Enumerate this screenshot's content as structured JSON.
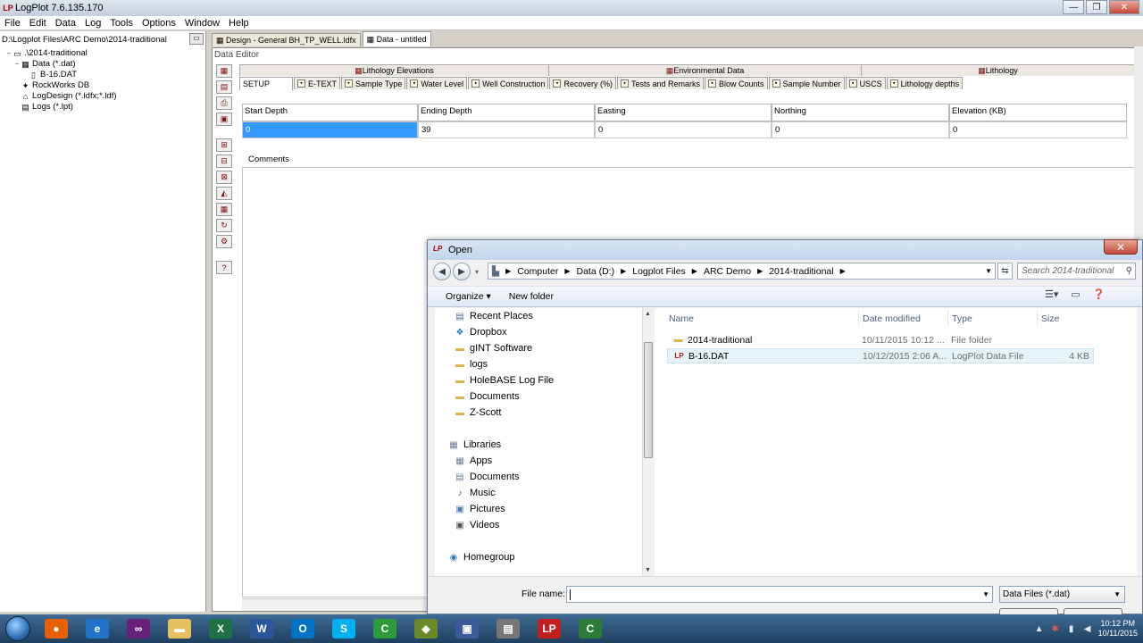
{
  "app": {
    "title": "LogPlot 7.6.135.170",
    "menu": [
      "File",
      "Edit",
      "Data",
      "Log",
      "Tools",
      "Options",
      "Window",
      "Help"
    ]
  },
  "left_pane": {
    "path": "D:\\Logplot Files\\ARC Demo\\2014-traditional",
    "tree": [
      {
        "label": ".\\2014-traditional",
        "indent": 0,
        "exp": "−",
        "icon": "folder-icon"
      },
      {
        "label": "Data (*.dat)",
        "indent": 1,
        "exp": "−",
        "icon": "data-table-icon"
      },
      {
        "label": "B-16.DAT",
        "indent": 2,
        "exp": "",
        "icon": "file-icon"
      },
      {
        "label": "RockWorks DB",
        "indent": 1,
        "exp": "",
        "icon": "rockworks-icon"
      },
      {
        "label": "LogDesign (*.ldfx;*.ldf)",
        "indent": 1,
        "exp": "",
        "icon": "logdesign-icon"
      },
      {
        "label": "Logs (*.lpt)",
        "indent": 1,
        "exp": "",
        "icon": "logs-icon"
      }
    ]
  },
  "doc_tabs": [
    {
      "label": "Design - General BH_TP_WELL.ldfx",
      "active": false
    },
    {
      "label": "Data - untitled",
      "active": true
    }
  ],
  "data_editor": {
    "title": "Data Editor",
    "sections": [
      {
        "label": "Lithology Elevations",
        "width": 346
      },
      {
        "label": "Environmental Data",
        "width": 350
      },
      {
        "label": "Lithology",
        "width": 306
      }
    ],
    "tabs": [
      "SETUP",
      "E-TEXT",
      "Sample Type",
      "Water Level",
      "Well Construction",
      "Recovery (%)",
      "Tests and Remarks",
      "Blow Counts",
      "Sample Number",
      "USCS",
      "Lithology depths"
    ],
    "columns": [
      "Start Depth",
      "Ending Depth",
      "Easting",
      "Northing",
      "Elevation (KB)"
    ],
    "values": [
      "0",
      "39",
      "0",
      "0",
      "0"
    ],
    "comments_label": "Comments"
  },
  "open_dialog": {
    "title": "Open",
    "breadcrumb": [
      "Computer",
      "Data (D:)",
      "Logplot Files",
      "ARC Demo",
      "2014-traditional"
    ],
    "search_placeholder": "Search 2014-traditional",
    "organize_label": "Organize ▾",
    "new_folder_label": "New folder",
    "nav_items": [
      {
        "label": "Recent Places",
        "icon": "recent-places-icon",
        "glyph": "▤",
        "color": "#4a6f9a",
        "level": 1
      },
      {
        "label": "Dropbox",
        "icon": "dropbox-icon",
        "glyph": "❖",
        "color": "#1e74c9",
        "level": 1
      },
      {
        "label": "gINT Software",
        "icon": "folder-icon",
        "glyph": "▬",
        "color": "#d9b44a",
        "level": 1
      },
      {
        "label": "logs",
        "icon": "folder-icon",
        "glyph": "▬",
        "color": "#d9b44a",
        "level": 1
      },
      {
        "label": "HoleBASE Log File",
        "icon": "folder-icon",
        "glyph": "▬",
        "color": "#d9b44a",
        "level": 1
      },
      {
        "label": "Documents",
        "icon": "folder-icon",
        "glyph": "▬",
        "color": "#d9b44a",
        "level": 1
      },
      {
        "label": "Z-Scott",
        "icon": "folder-icon",
        "glyph": "▬",
        "color": "#d9b44a",
        "level": 1
      },
      {
        "label": "Libraries",
        "icon": "libraries-icon",
        "glyph": "▦",
        "color": "#6b7f99",
        "level": 0
      },
      {
        "label": "Apps",
        "icon": "apps-icon",
        "glyph": "▦",
        "color": "#6b7f99",
        "level": 1
      },
      {
        "label": "Documents",
        "icon": "documents-icon",
        "glyph": "▤",
        "color": "#6b7f99",
        "level": 1
      },
      {
        "label": "Music",
        "icon": "music-icon",
        "glyph": "♪",
        "color": "#2f5f9a",
        "level": 1
      },
      {
        "label": "Pictures",
        "icon": "pictures-icon",
        "glyph": "▣",
        "color": "#4a7ab0",
        "level": 1
      },
      {
        "label": "Videos",
        "icon": "videos-icon",
        "glyph": "▣",
        "color": "#555",
        "level": 1
      },
      {
        "label": "Homegroup",
        "icon": "homegroup-icon",
        "glyph": "◉",
        "color": "#2d7fc1",
        "level": 0
      }
    ],
    "columns": [
      "Name",
      "Date modified",
      "Type",
      "Size"
    ],
    "files": [
      {
        "name": "2014-traditional",
        "date": "10/11/2015 10:12 ...",
        "type": "File folder",
        "size": "",
        "icon": "folder-icon"
      },
      {
        "name": "B-16.DAT",
        "date": "10/12/2015 2:06 A...",
        "type": "LogPlot Data File",
        "size": "4 KB",
        "icon": "logplot-file-icon"
      }
    ],
    "file_name_label": "File name:",
    "file_name_value": "",
    "file_type": "Data Files (*.dat)"
  },
  "taskbar": {
    "apps": [
      {
        "name": "firefox-icon",
        "glyph": "●",
        "bg": "#e66000"
      },
      {
        "name": "internet-explorer-icon",
        "glyph": "e",
        "bg": "#1f74c8"
      },
      {
        "name": "visual-studio-icon",
        "glyph": "∞",
        "bg": "#68217a"
      },
      {
        "name": "file-explorer-icon",
        "glyph": "▬",
        "bg": "#e4c060"
      },
      {
        "name": "excel-icon",
        "glyph": "X",
        "bg": "#1f7244"
      },
      {
        "name": "word-icon",
        "glyph": "W",
        "bg": "#2b579a"
      },
      {
        "name": "outlook-icon",
        "glyph": "O",
        "bg": "#0072c6"
      },
      {
        "name": "skype-icon",
        "glyph": "S",
        "bg": "#00aff0"
      },
      {
        "name": "camtasia-icon",
        "glyph": "C",
        "bg": "#2e9a3a"
      },
      {
        "name": "rockworks-icon",
        "glyph": "◆",
        "bg": "#6a8a2a"
      },
      {
        "name": "app-icon",
        "glyph": "▣",
        "bg": "#3a5a9a"
      },
      {
        "name": "scanner-icon",
        "glyph": "▤",
        "bg": "#777"
      },
      {
        "name": "logplot-icon",
        "glyph": "LP",
        "bg": "#c02020"
      },
      {
        "name": "camtasia-recorder-icon",
        "glyph": "C",
        "bg": "#2e7a3a"
      }
    ],
    "time": "10:12 PM",
    "date": "10/11/2015"
  }
}
